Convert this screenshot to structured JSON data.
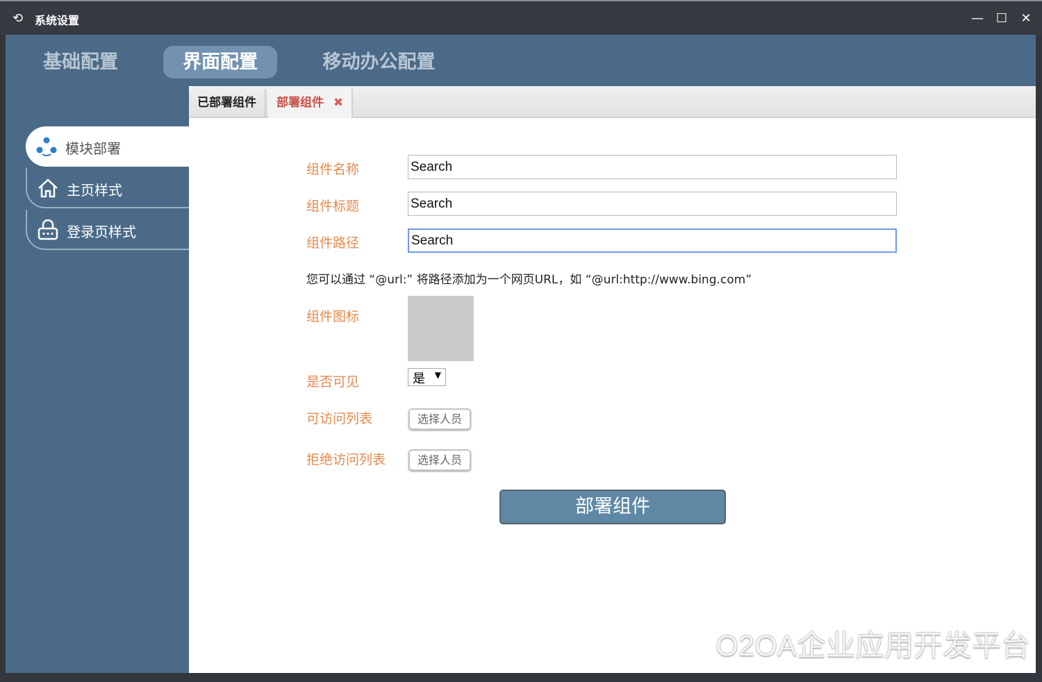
{
  "window": {
    "title": "系统设置",
    "minimize": "—",
    "maximize": "☐",
    "close": "✕"
  },
  "top_tabs": [
    {
      "label": "基础配置"
    },
    {
      "label": "界面配置"
    },
    {
      "label": "移动办公配置"
    }
  ],
  "sidebar": {
    "items": [
      {
        "label": "模块部署"
      },
      {
        "label": "主页样式"
      },
      {
        "label": "登录页样式"
      }
    ]
  },
  "sub_tabs": [
    {
      "label": "已部署组件"
    },
    {
      "label": "部署组件",
      "close": "✖"
    }
  ],
  "form": {
    "name_label": "组件名称",
    "name_value": "Search",
    "title_label": "组件标题",
    "title_value": "Search",
    "path_label": "组件路径",
    "path_value": "Search",
    "hint": "您可以通过 “@url:” 将路径添加为一个网页URL，如 “@url:http://www.bing.com”",
    "icon_label": "组件图标",
    "visible_label": "是否可见",
    "visible_value": "是",
    "allow_label": "可访问列表",
    "allow_button": "选择人员",
    "deny_label": "拒绝访问列表",
    "deny_button": "选择人员",
    "submit": "部署组件"
  },
  "watermark": "O2OA企业应用开发平台"
}
